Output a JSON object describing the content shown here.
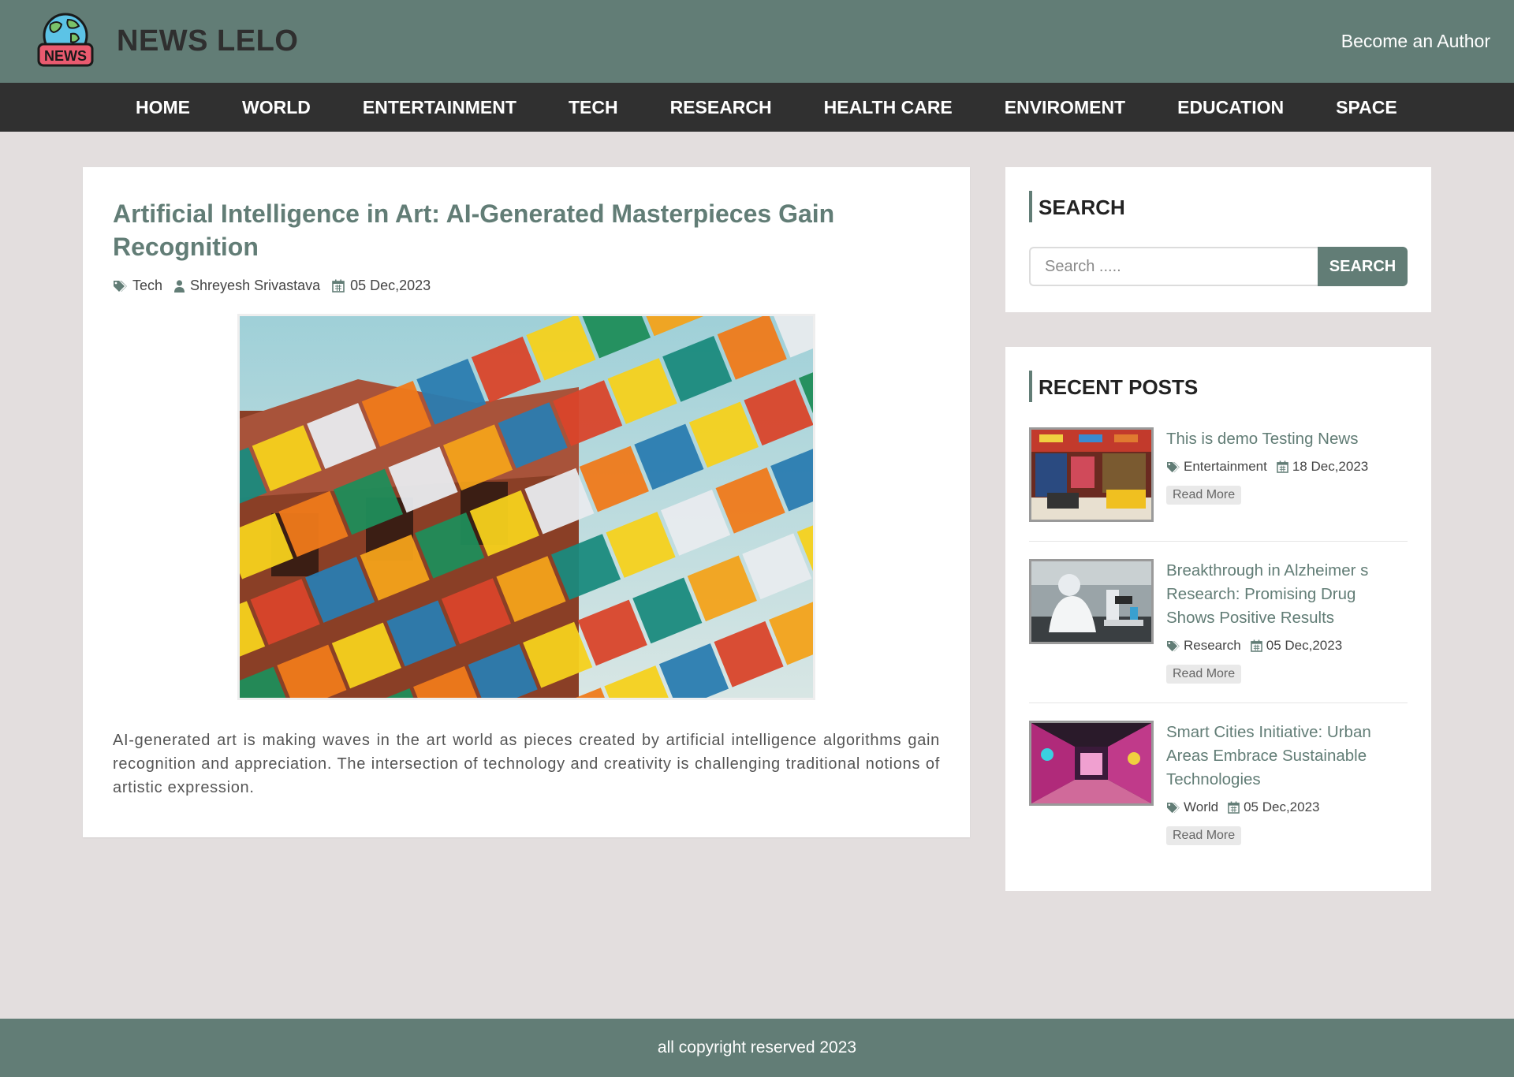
{
  "header": {
    "logo_badge": "NEWS",
    "site_title": "NEWS LELO",
    "become_author": "Become an Author"
  },
  "nav": {
    "items": [
      "HOME",
      "WORLD",
      "ENTERTAINMENT",
      "TECH",
      "RESEARCH",
      "HEALTH CARE",
      "ENVIROMENT",
      "EDUCATION",
      "SPACE"
    ]
  },
  "article": {
    "title": "Artificial Intelligence in Art: AI-Generated Masterpieces Gain Recognition",
    "category": "Tech",
    "author": "Shreyesh Srivastava",
    "date": "05 Dec,2023",
    "body": "AI-generated art is making waves in the art world as pieces created by artificial intelligence algorithms gain recognition and appreciation. The intersection of technology and creativity is challenging traditional notions of artistic expression."
  },
  "search": {
    "heading": "SEARCH",
    "placeholder": "Search .....",
    "button_label": "SEARCH"
  },
  "recent": {
    "heading": "RECENT POSTS",
    "read_more": "Read More",
    "posts": [
      {
        "title": "This is demo Testing News",
        "category": "Entertainment",
        "date": "18 Dec,2023"
      },
      {
        "title": "Breakthrough in Alzheimer s Research: Promising Drug Shows Positive Results",
        "category": "Research",
        "date": "05 Dec,2023"
      },
      {
        "title": "Smart Cities Initiative: Urban Areas Embrace Sustainable Technologies",
        "category": "World",
        "date": "05 Dec,2023"
      }
    ]
  },
  "footer": {
    "text": "all copyright reserved 2023"
  },
  "colors": {
    "brand": "#627d76",
    "nav_bg": "#303030",
    "page_bg": "#e3dede"
  },
  "icons": {
    "tag": "tag-icon",
    "user": "user-icon",
    "calendar": "calendar-icon"
  }
}
